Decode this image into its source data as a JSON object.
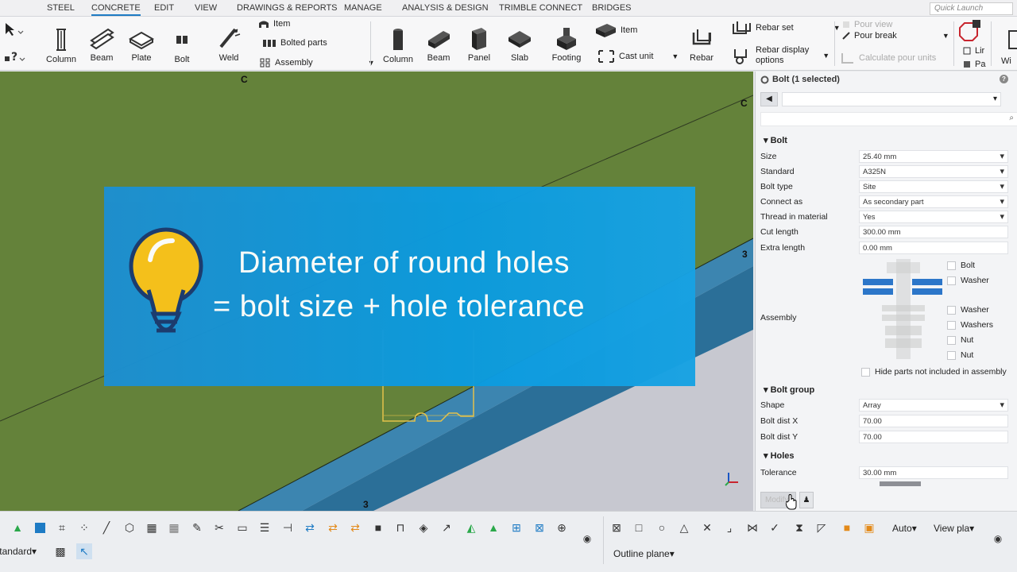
{
  "menu": {
    "tabs": [
      "STEEL",
      "CONCRETE",
      "EDIT",
      "VIEW",
      "DRAWINGS & REPORTS",
      "MANAGE",
      "ANALYSIS & DESIGN",
      "TRIMBLE CONNECT",
      "BRIDGES"
    ],
    "active_tab": "CONCRETE",
    "quick_launch_placeholder": "Quick Launch"
  },
  "ribbon": {
    "steel": {
      "column": "Column",
      "beam": "Beam",
      "plate": "Plate",
      "bolt": "Bolt",
      "weld": "Weld",
      "item": "Item",
      "bolted_parts": "Bolted parts",
      "assembly": "Assembly"
    },
    "concrete": {
      "column": "Column",
      "beam": "Beam",
      "panel": "Panel",
      "slab": "Slab",
      "footing": "Footing",
      "item": "Item",
      "cast_unit": "Cast unit",
      "rebar": "Rebar",
      "rebar_set": "Rebar set",
      "rebar_display_l1": "Rebar display",
      "rebar_display_l2": "options",
      "pour_view": "Pour view",
      "pour_break": "Pour break",
      "calculate_pour_units": "Calculate pour units",
      "lir": "Lir",
      "pa": "Pa",
      "wi": "Wi"
    }
  },
  "viewport": {
    "grid_labels": {
      "c_top": "C",
      "c_right": "C",
      "three_right": "3",
      "three_bottom": "3"
    }
  },
  "banner": {
    "line1": "Diameter of round holes",
    "line2": "= bolt size + hole tolerance",
    "colors": {
      "bg": "#1a96d8",
      "bulb": "#f9c21a",
      "outline": "#1a3a70"
    }
  },
  "panel": {
    "title": "Bolt (1 selected)",
    "sections": {
      "bolt": "Bolt",
      "bolt_group": "Bolt group",
      "holes": "Holes"
    },
    "bolt_props": [
      {
        "label": "Size",
        "value": "25.40 mm",
        "dropdown": true
      },
      {
        "label": "Standard",
        "value": "A325N",
        "dropdown": true
      },
      {
        "label": "Bolt type",
        "value": "Site",
        "dropdown": true
      },
      {
        "label": "Connect as",
        "value": "As secondary part",
        "dropdown": true
      },
      {
        "label": "Thread in material",
        "value": "Yes",
        "dropdown": true
      },
      {
        "label": "Cut length",
        "value": "300.00 mm",
        "dropdown": false
      },
      {
        "label": "Extra length",
        "value": "0.00 mm",
        "dropdown": false
      }
    ],
    "assembly_label": "Assembly",
    "assembly_checks": [
      "Bolt",
      "Washer",
      "Washer",
      "Washers",
      "Nut",
      "Nut"
    ],
    "hide_parts_label": "Hide parts not included in assembly",
    "group_props": [
      {
        "label": "Shape",
        "value": "Array",
        "dropdown": true
      },
      {
        "label": "Bolt dist X",
        "value": "70.00",
        "dropdown": false
      },
      {
        "label": "Bolt dist Y",
        "value": "70.00",
        "dropdown": false
      }
    ],
    "hole_props": [
      {
        "label": "Tolerance",
        "value": "30.00 mm",
        "dropdown": false
      }
    ],
    "modify_label": "Modify"
  },
  "bottom_toolbar": {
    "standard_select": "Standard",
    "auto_select": "Auto",
    "view_plane_select": "View pla",
    "outline_plane_select": "Outline plane"
  }
}
